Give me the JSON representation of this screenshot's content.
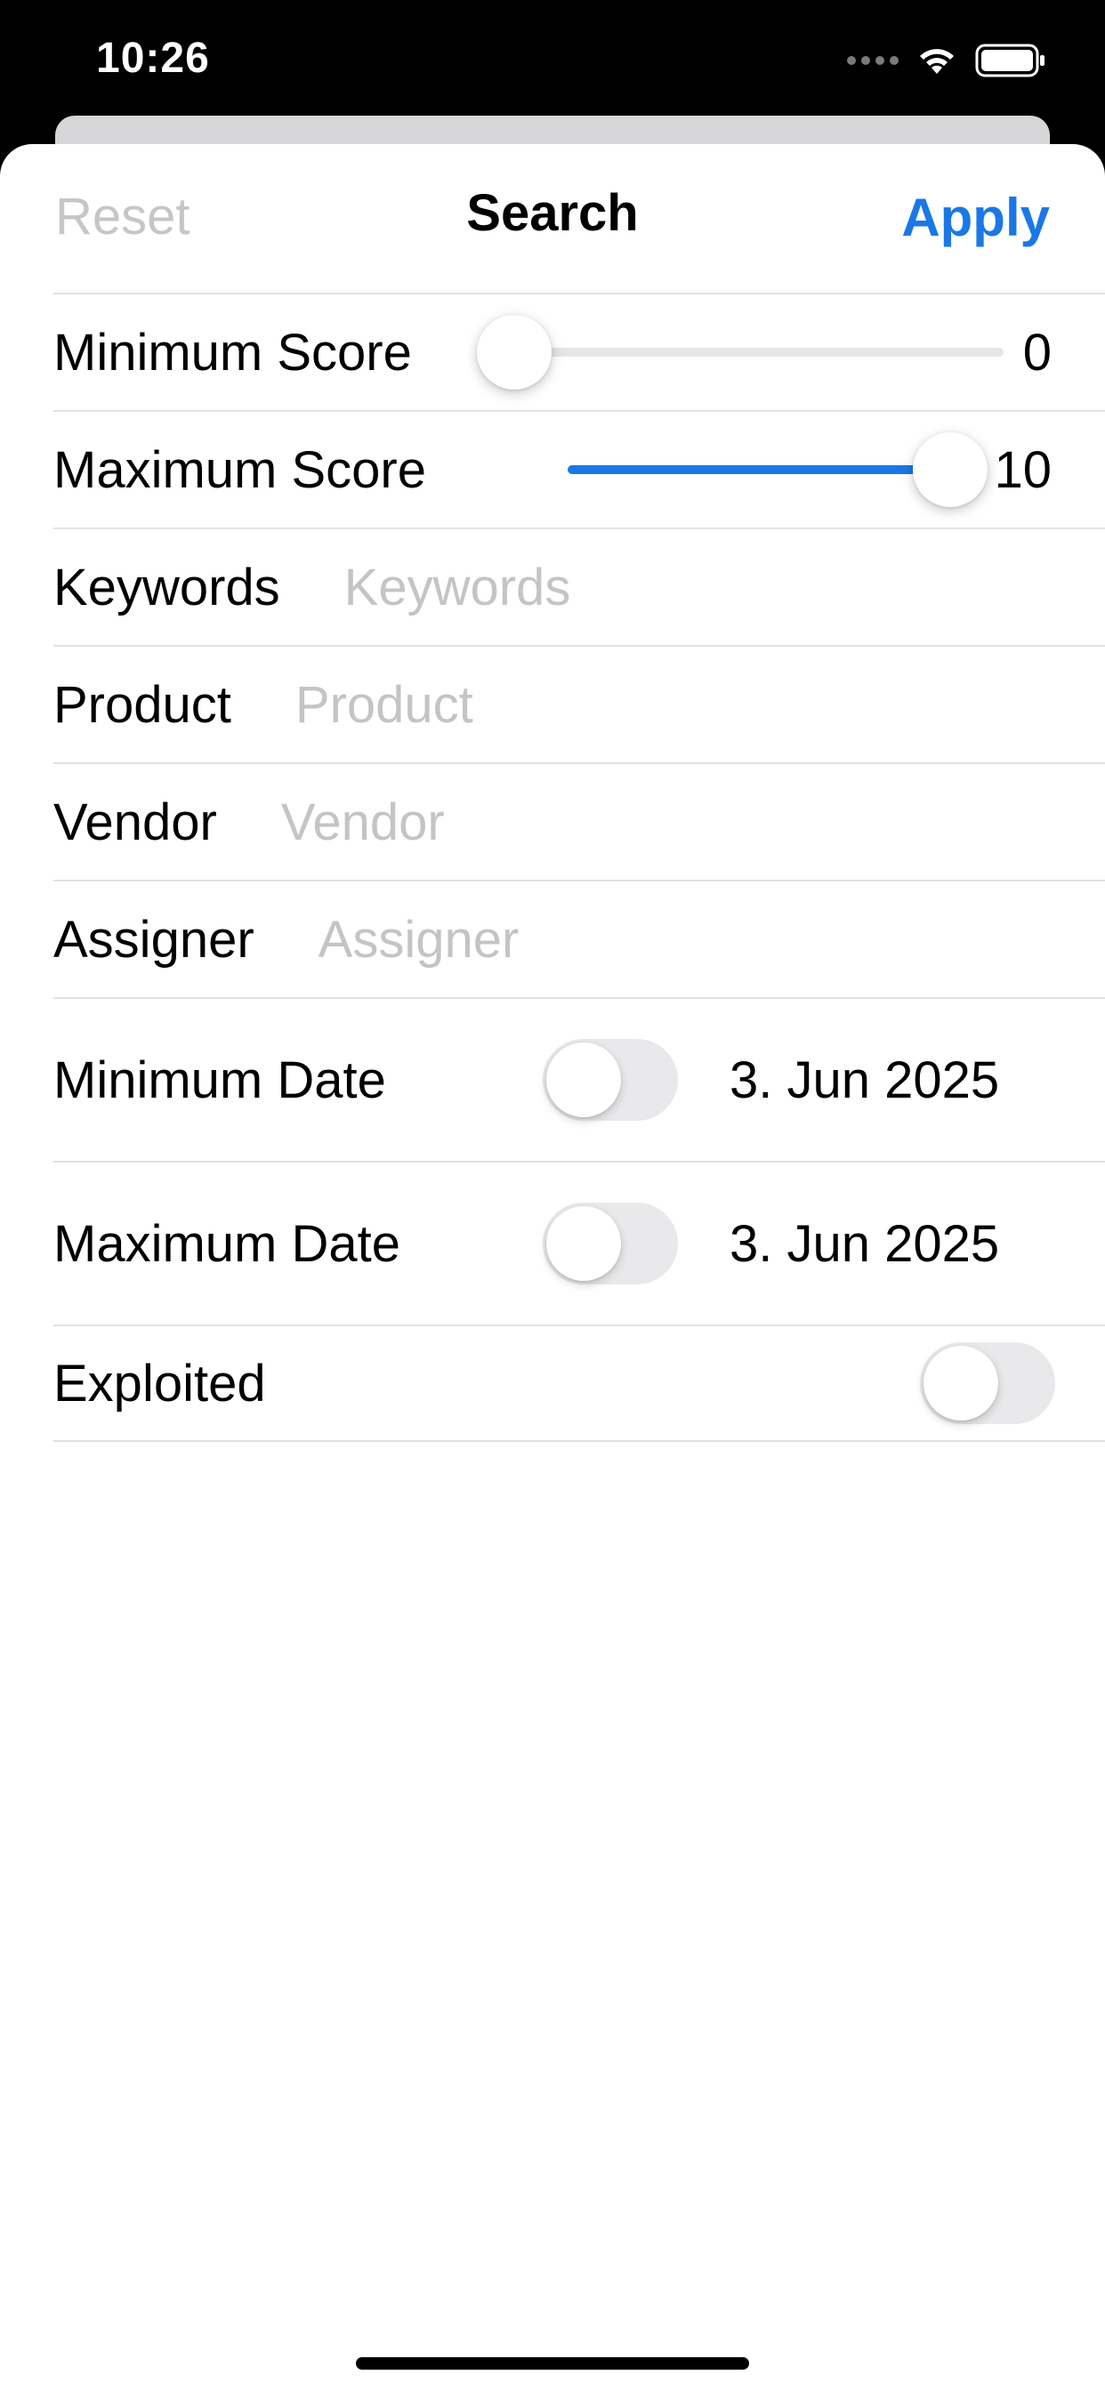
{
  "status_bar": {
    "time": "10:26"
  },
  "nav": {
    "reset_label": "Reset",
    "title": "Search",
    "apply_label": "Apply",
    "reset_color": "#c6c6c8",
    "apply_color": "#1a78e6"
  },
  "form": {
    "min_score": {
      "label": "Minimum Score",
      "value": "0",
      "min": 0,
      "max": 10,
      "current": 0
    },
    "max_score": {
      "label": "Maximum Score",
      "value": "10",
      "min": 0,
      "max": 10,
      "current": 10
    },
    "keywords": {
      "label": "Keywords",
      "value": "",
      "placeholder": "Keywords"
    },
    "product": {
      "label": "Product",
      "value": "",
      "placeholder": "Product"
    },
    "vendor": {
      "label": "Vendor",
      "value": "",
      "placeholder": "Vendor"
    },
    "assigner": {
      "label": "Assigner",
      "value": "",
      "placeholder": "Assigner"
    },
    "min_date": {
      "label": "Minimum Date",
      "enabled": false,
      "date": "3. Jun 2025"
    },
    "max_date": {
      "label": "Maximum Date",
      "enabled": false,
      "date": "3. Jun 2025"
    },
    "exploited": {
      "label": "Exploited",
      "enabled": false
    }
  },
  "colors": {
    "accent": "#1a78e6",
    "separator": "#e2e2e4",
    "placeholder": "#c4c4c7",
    "toggle_off": "#e9e9eb"
  }
}
